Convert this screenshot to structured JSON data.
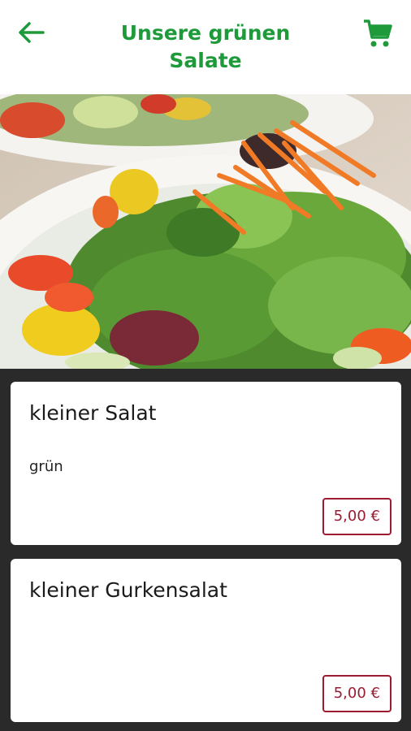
{
  "header": {
    "title": "Unsere grünen Salate",
    "back_icon": "arrow-left-icon",
    "cart_icon": "shopping-cart-icon",
    "accent_color": "#1e9a3b"
  },
  "hero": {
    "image": "salad-photo"
  },
  "products": [
    {
      "name": "kleiner Salat",
      "description": "grün",
      "price": "5,00 €"
    },
    {
      "name": "kleiner Gurkensalat",
      "description": "",
      "price": "5,00 €"
    }
  ],
  "colors": {
    "price": "#9b1b30",
    "list_background": "#2a2a2a"
  }
}
